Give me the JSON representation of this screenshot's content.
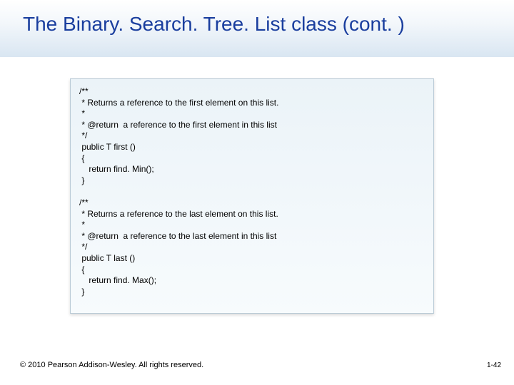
{
  "title": "The Binary. Search. Tree. List class (cont. )",
  "code": "/**\n * Returns a reference to the first element on this list.\n *\n * @return  a reference to the first element in this list\n */\n public T first ()\n {\n    return find. Min();\n }\n\n/**\n * Returns a reference to the last element on this list.\n *\n * @return  a reference to the last element in this list\n */\n public T last ()\n {\n    return find. Max();\n }",
  "footer": "© 2010 Pearson Addison-Wesley. All rights reserved.",
  "pagenum": "1-42"
}
